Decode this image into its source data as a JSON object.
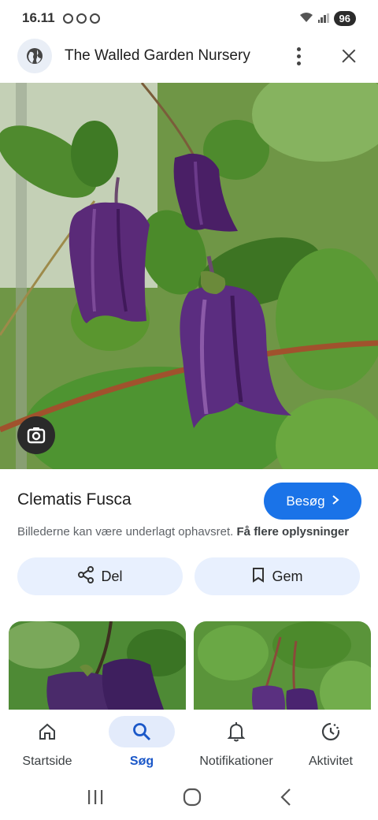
{
  "status_bar": {
    "time": "16.11",
    "battery": "96"
  },
  "header": {
    "site_title": "The Walled Garden Nursery"
  },
  "result": {
    "title": "Clematis Fusca",
    "visit_label": "Besøg",
    "copyright_text": "Billederne kan være underlagt ophavsret.",
    "more_info_link": "Få flere oplysninger",
    "share_label": "Del",
    "save_label": "Gem"
  },
  "bottom_nav": {
    "items": [
      {
        "label": "Startside",
        "icon": "home-icon",
        "active": false
      },
      {
        "label": "Søg",
        "icon": "search-icon",
        "active": true
      },
      {
        "label": "Notifikationer",
        "icon": "bell-icon",
        "active": false
      },
      {
        "label": "Aktivitet",
        "icon": "activity-icon",
        "active": false
      }
    ]
  },
  "colors": {
    "accent": "#1a73e8",
    "chip_bg": "#e8f0fe",
    "flower": "#5a2a78",
    "leaf": "#5e8a3a"
  }
}
